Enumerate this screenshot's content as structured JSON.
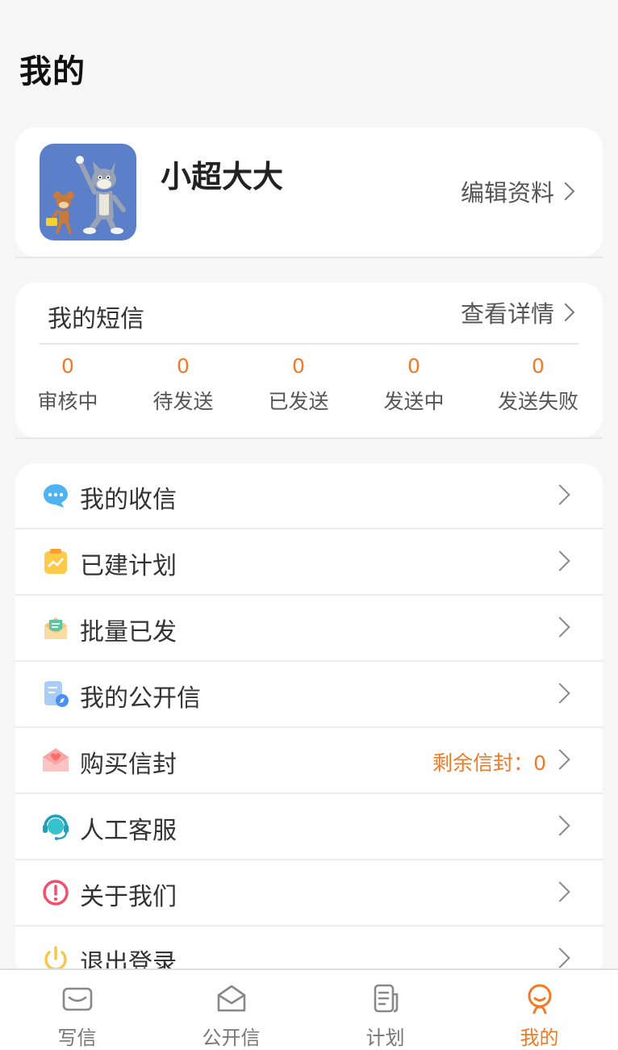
{
  "page": {
    "title": "我的"
  },
  "profile": {
    "name": "小超大大",
    "edit_label": "编辑资料"
  },
  "sms": {
    "title": "我的短信",
    "detail_label": "查看详情",
    "stats": [
      {
        "count": "0",
        "label": "审核中"
      },
      {
        "count": "0",
        "label": "待发送"
      },
      {
        "count": "0",
        "label": "已发送"
      },
      {
        "count": "0",
        "label": "发送中"
      },
      {
        "count": "0",
        "label": "发送失败"
      }
    ]
  },
  "menu": {
    "items": [
      {
        "label": "我的收信",
        "icon": "chat-bubble-icon"
      },
      {
        "label": "已建计划",
        "icon": "clipboard-chart-icon"
      },
      {
        "label": "批量已发",
        "icon": "open-envelope-icon"
      },
      {
        "label": "我的公开信",
        "icon": "document-compass-icon"
      },
      {
        "label": "购买信封",
        "icon": "heart-envelope-icon",
        "extra": "剩余信封：0"
      },
      {
        "label": "人工客服",
        "icon": "headset-icon"
      },
      {
        "label": "关于我们",
        "icon": "alert-circle-icon"
      },
      {
        "label": "退出登录",
        "icon": "power-icon"
      }
    ]
  },
  "tabbar": {
    "tabs": [
      {
        "label": "写信",
        "icon": "mail-icon"
      },
      {
        "label": "公开信",
        "icon": "open-mail-icon"
      },
      {
        "label": "计划",
        "icon": "document-icon"
      },
      {
        "label": "我的",
        "icon": "user-icon",
        "active": true
      }
    ]
  },
  "colors": {
    "accent": "#f07a26",
    "background": "#f6f6f6"
  }
}
